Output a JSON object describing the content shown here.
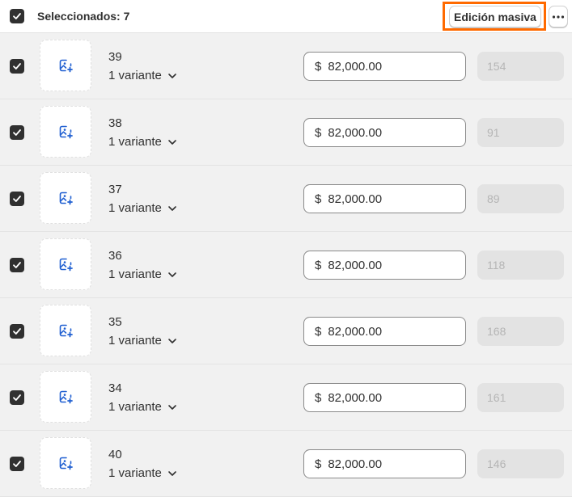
{
  "header": {
    "selected_label": "Seleccionados: 7",
    "bulk_edit_label": "Edición masiva",
    "more_icon": "ellipsis-horizontal-icon"
  },
  "colors": {
    "checkbox": "#303030",
    "highlight": "#ff6a00",
    "image_icon": "#1f5fd1"
  },
  "rows": [
    {
      "title": "39",
      "variants": "1 variante",
      "currency": "$",
      "price": "82,000.00",
      "quantity": "154"
    },
    {
      "title": "38",
      "variants": "1 variante",
      "currency": "$",
      "price": "82,000.00",
      "quantity": "91"
    },
    {
      "title": "37",
      "variants": "1 variante",
      "currency": "$",
      "price": "82,000.00",
      "quantity": "89"
    },
    {
      "title": "36",
      "variants": "1 variante",
      "currency": "$",
      "price": "82,000.00",
      "quantity": "118"
    },
    {
      "title": "35",
      "variants": "1 variante",
      "currency": "$",
      "price": "82,000.00",
      "quantity": "168"
    },
    {
      "title": "34",
      "variants": "1 variante",
      "currency": "$",
      "price": "82,000.00",
      "quantity": "161"
    },
    {
      "title": "40",
      "variants": "1 variante",
      "currency": "$",
      "price": "82,000.00",
      "quantity": "146"
    }
  ]
}
